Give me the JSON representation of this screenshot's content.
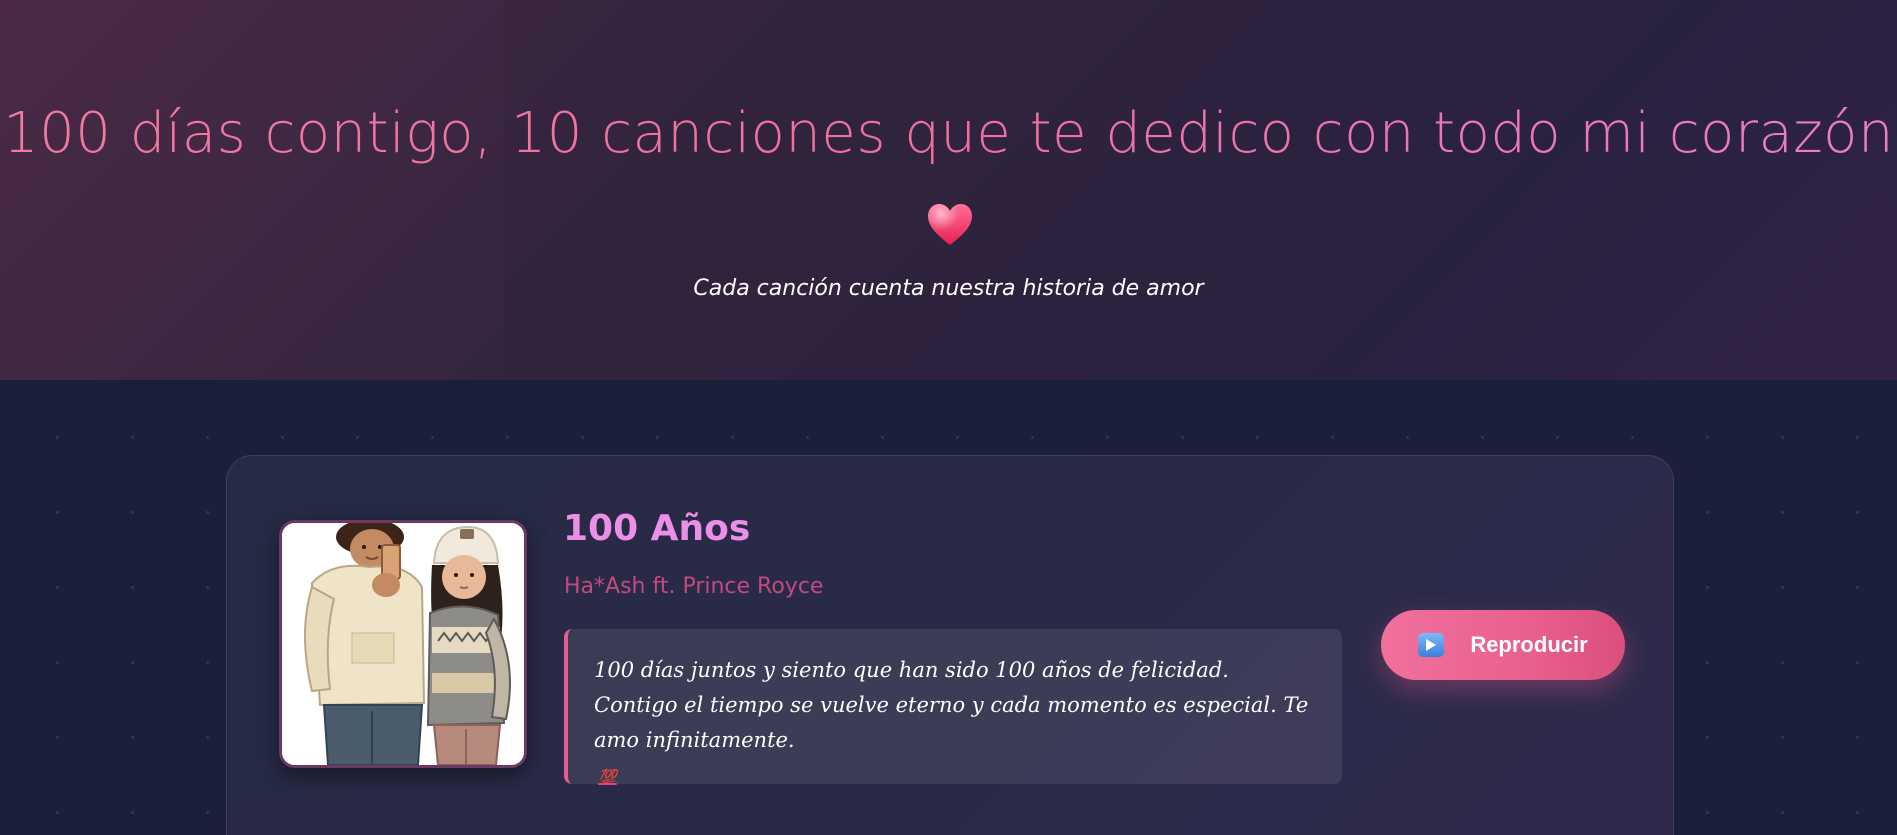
{
  "hero": {
    "title": "100 días contigo, 10 canciones que te dedico con todo mi corazón",
    "heart_icon": "heart-icon",
    "subtitle": "Cada canción cuenta nuestra historia de amor"
  },
  "song": {
    "title": "100 Años",
    "artist": "Ha*Ash ft. Prince Royce",
    "dedication": "100 días juntos y siento que han sido 100 años de felicidad. Contigo el tiempo se vuelve eterno y cada momento es especial. Te amo infinitamente.",
    "dedication_emoji": "💯",
    "play_label": "Reproducir",
    "play_icon": "play-icon",
    "cover_icon": "couple-illustration"
  },
  "colors": {
    "accent_pink": "#e9608f",
    "title_pink": "#ec8fe6",
    "artist_pink": "#c04b7e",
    "background": "#1b1f3a"
  }
}
